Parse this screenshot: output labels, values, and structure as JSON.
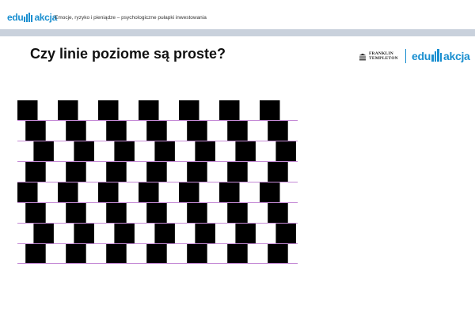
{
  "header": {
    "logo_left": "edu",
    "logo_right": "akcja",
    "breadcrumb": "Emocje, ryzyko i pieniądze – psychologiczne pułapki inwestowania"
  },
  "slide": {
    "title": "Czy linie poziome są proste?"
  },
  "partner": {
    "name_line1": "FRANKLIN",
    "name_line2": "TEMPLETON"
  },
  "brand": {
    "logo_left": "edu",
    "logo_right": "akcja"
  },
  "illusion": {
    "rows": 8,
    "tile_count_per_row": 7,
    "row_offsets_fraction": [
      0,
      0.2,
      0.4,
      0.2,
      0,
      0.2,
      0.4,
      0.2
    ],
    "colors": {
      "tile": "#000000",
      "mortar": "#c58ad6",
      "background": "#ffffff"
    }
  },
  "colors": {
    "brand_blue": "#1a8fd0",
    "strip": "#c9d1dc",
    "title": "#111111"
  }
}
